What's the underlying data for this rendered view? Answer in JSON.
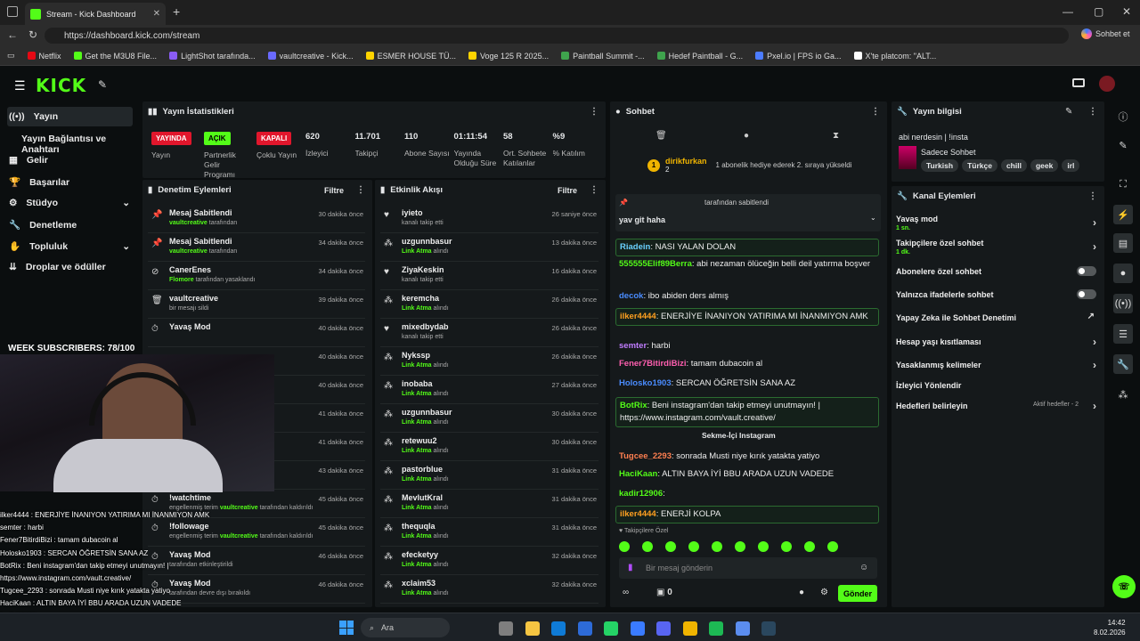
{
  "browser": {
    "tab_title": "Stream - Kick Dashboard",
    "url": "https://dashboard.kick.com/stream",
    "copilot": "Sohbet et",
    "bookmarks": [
      "Netflix",
      "Get the M3U8 File...",
      "LightShot tarafında...",
      "vaultcreative - Kick...",
      "ESMER HOUSE TÜ...",
      "Voge 125 R 2025...",
      "Paintball Summit -...",
      "Hedef Paintball - G...",
      "Pxel.io | FPS io Ga...",
      "X'te platcom: \"ALT..."
    ]
  },
  "brand": {
    "logo": "KICK",
    "beta": "BETA"
  },
  "sidebar": {
    "items": [
      "Yayın",
      "Yayın Bağlantısı ve Anahtarı",
      "Gelir",
      "Başarılar",
      "Stüdyo",
      "Denetleme",
      "Topluluk",
      "Droplar ve ödüller"
    ]
  },
  "stats": {
    "title": "Yayın İstatistikleri",
    "badges": [
      {
        "label": "YAYINDA",
        "sub": "Yayın",
        "color": "#e1162c"
      },
      {
        "label": "AÇIK",
        "sub": "Partnerlik Gelir Programı",
        "color": "#53fc18"
      },
      {
        "label": "KAPALI",
        "sub": "Çoklu Yayın",
        "color": "#e1162c"
      }
    ],
    "items": [
      {
        "value": "620",
        "label": "İzleyici"
      },
      {
        "value": "11.701",
        "label": "Takipçi"
      },
      {
        "value": "110",
        "label": "Abone Sayısı"
      },
      {
        "value": "01:11:54",
        "label": "Yayında Olduğu Süre"
      },
      {
        "value": "58",
        "label": "Ort. Sohbete Katılanlar"
      },
      {
        "value": "%9",
        "label": "% Katılım"
      }
    ]
  },
  "moderation": {
    "title": "Denetim Eylemleri",
    "filter": "Filtre",
    "rows": [
      {
        "icon": "pin-icon",
        "title": "Mesaj Sabitlendi",
        "user": "vaultcreative",
        "rest": " tarafından",
        "time": "30 dakika önce"
      },
      {
        "icon": "pin-icon",
        "title": "Mesaj Sabitlendi",
        "user": "vaultcreative",
        "rest": " tarafından",
        "time": "34 dakika önce"
      },
      {
        "icon": "ban-icon",
        "title": "CanerEnes",
        "user": "Flomore",
        "rest": " tarafından yasaklandı",
        "time": "34 dakika önce"
      },
      {
        "icon": "trash-icon",
        "title": "vaultcreative",
        "user": "",
        "rest": "bir mesajı sildi",
        "time": "39 dakika önce"
      },
      {
        "icon": "clock-icon",
        "title": "Yavaş Mod",
        "user": "",
        "rest": "",
        "time": "40 dakika önce"
      },
      {
        "icon": "",
        "title": "",
        "user": "",
        "rest": "",
        "time": "40 dakika önce"
      },
      {
        "icon": "",
        "title": "",
        "user": "",
        "rest": "kildi",
        "time": "40 dakika önce"
      },
      {
        "icon": "",
        "title": "",
        "user": "",
        "rest": "",
        "time": "41 dakika önce"
      },
      {
        "icon": "",
        "title": "",
        "user": "",
        "rest": "",
        "time": "41 dakika önce"
      },
      {
        "icon": "",
        "title": "",
        "user": "",
        "rest": "",
        "time": "43 dakika önce"
      },
      {
        "icon": "clock-icon",
        "title": "!watchtime",
        "user": "vaultcreative",
        "rest": " tarafından kaldırıldı",
        "pre": "engellenmiş terim ",
        "time": "45 dakika önce"
      },
      {
        "icon": "clock-icon",
        "title": "!followage",
        "user": "vaultcreative",
        "rest": " tarafından kaldırıldı",
        "pre": "engellenmiş terim ",
        "time": "45 dakika önce"
      },
      {
        "icon": "clock-icon",
        "title": "Yavaş Mod",
        "user": "",
        "rest": "tarafından etkinleştirildi",
        "time": "46 dakika önce"
      },
      {
        "icon": "clock-icon",
        "title": "Yavaş Mod",
        "user": "",
        "rest": "tarafından devre dışı bırakıldı",
        "time": "46 dakika önce"
      }
    ]
  },
  "activity": {
    "title": "Etkinlik Akışı",
    "filter": "Filtre",
    "rows": [
      {
        "icon": "heart-icon",
        "name": "iyieto",
        "sub": "kanalı takip etti",
        "time": "26 saniye önce",
        "green": false
      },
      {
        "icon": "loot-icon",
        "name": "uzgunnbasur",
        "sub": "Link Atma",
        "sub2": " alındı",
        "time": "13 dakika önce",
        "green": true
      },
      {
        "icon": "heart-icon",
        "name": "ZiyaKeskin",
        "sub": "kanalı takip etti",
        "time": "16 dakika önce",
        "green": false
      },
      {
        "icon": "loot-icon",
        "name": "keremcha",
        "sub": "Link Atma",
        "sub2": " alındı",
        "time": "26 dakika önce",
        "green": true
      },
      {
        "icon": "heart-icon",
        "name": "mixedbydab",
        "sub": "kanalı takip etti",
        "time": "26 dakika önce",
        "green": false
      },
      {
        "icon": "loot-icon",
        "name": "Nykssp",
        "sub": "Link Atma",
        "sub2": " alındı",
        "time": "26 dakika önce",
        "green": true
      },
      {
        "icon": "loot-icon",
        "name": "inobaba",
        "sub": "Link Atma",
        "sub2": " alındı",
        "time": "27 dakika önce",
        "green": true
      },
      {
        "icon": "loot-icon",
        "name": "uzgunnbasur",
        "sub": "Link Atma",
        "sub2": " alındı",
        "time": "30 dakika önce",
        "green": true
      },
      {
        "icon": "loot-icon",
        "name": "retewuu2",
        "sub": "Link Atma",
        "sub2": " alındı",
        "time": "30 dakika önce",
        "green": true
      },
      {
        "icon": "loot-icon",
        "name": "pastorblue",
        "sub": "Link Atma",
        "sub2": " alındı",
        "time": "31 dakika önce",
        "green": true
      },
      {
        "icon": "loot-icon",
        "name": "MevlutKral",
        "sub": "Link Atma",
        "sub2": " alındı",
        "time": "31 dakika önce",
        "green": true
      },
      {
        "icon": "loot-icon",
        "name": "thequqla",
        "sub": "Link Atma",
        "sub2": " alındı",
        "time": "31 dakika önce",
        "green": true
      },
      {
        "icon": "loot-icon",
        "name": "efecketyy",
        "sub": "Link Atma",
        "sub2": " alındı",
        "time": "32 dakika önce",
        "green": true
      },
      {
        "icon": "loot-icon",
        "name": "xclaim53",
        "sub": "Link Atma",
        "sub2": " alındı",
        "time": "32 dakika önce",
        "green": true
      }
    ]
  },
  "chat": {
    "title": "Sohbet",
    "gift_user": "dirikfurkan",
    "gift_count": "2",
    "gift_text": "1 abonelik hediye ederek 2. sıraya yükseldi",
    "pinned_by": "tarafından sabitlendi",
    "pinned_msg": "yav git haha",
    "messages": [
      {
        "user": "Riadein",
        "color": "#6ad0ff",
        "text": "NASI YALAN DOLAN",
        "hl": true
      },
      {
        "user": "555555Elif89Berra",
        "color": "#53fc18",
        "text": "abi nezaman ölüceğin belli deil yatırma boşver",
        "hl": false
      },
      {
        "user": "decok",
        "color": "#4a8cff",
        "text": "ibo abiden ders almış",
        "hl": false
      },
      {
        "user": "ilker4444",
        "color": "#ffa020",
        "text": "ENERJİYE İNANIYON YATIRIMA MI İNANMIYON AMK",
        "hl": true
      },
      {
        "user": "semter",
        "color": "#c07cff",
        "text": "harbi",
        "hl": false
      },
      {
        "user": "Fener7BitirdiBizi",
        "color": "#ff5fb0",
        "text": "tamam dubacoin al",
        "hl": false
      },
      {
        "user": "Holosko1903",
        "color": "#4a8cff",
        "text": "SERCAN ÖĞRETSİN SANA AZ",
        "hl": false
      },
      {
        "user": "BotRix",
        "color": "#53fc18",
        "text": "Beni instagram'dan takip etmeyi unutmayın! | https://www.instagram.com/vault.creative/",
        "hl": true
      },
      {
        "user": "Tugcee_2293",
        "color": "#ff7f50",
        "text": "sonrada Musti niye kırık yatakta yatiyo",
        "hl": false
      },
      {
        "user": "HaciKaan",
        "color": "#53fc18",
        "text": "ALTIN BAYA İYİ BBU ARADA UZUN VADEDE",
        "hl": false
      },
      {
        "user": "kadir12906",
        "color": "#53fc18",
        "text": "",
        "hl": false
      },
      {
        "user": "ilker4444",
        "color": "#ffa020",
        "text": "ENERJİ KOLPA",
        "hl": true
      }
    ],
    "instagram_btn": "Sekme-İçi Instagram",
    "followers_only": "Takipçilere Özel",
    "placeholder": "Bir mesaj gönderin",
    "count": "0",
    "send": "Gönder"
  },
  "stream_info": {
    "title": "Yayın bilgisi",
    "stream_title": "abi nerdesin | !insta",
    "category": "Sadece Sohbet",
    "tags": [
      "Turkish",
      "Türkçe",
      "chill",
      "geek",
      "irl"
    ]
  },
  "channel_actions": {
    "title": "Kanal Eylemleri",
    "items": [
      {
        "label": "Yavaş mod",
        "sub": "1 sn.",
        "ctl": "chev"
      },
      {
        "label": "Takipçilere özel sohbet",
        "sub": "1 dk.",
        "ctl": "chev"
      },
      {
        "label": "Abonelere özel sohbet",
        "sub": "",
        "ctl": "toggle"
      },
      {
        "label": "Yalnızca ifadelerle sohbet",
        "sub": "",
        "ctl": "toggle"
      },
      {
        "label": "Yapay Zeka ile Sohbet Denetimi",
        "sub": "",
        "ctl": "ext"
      },
      {
        "label": "Hesap yaşı kısıtlaması",
        "sub": "",
        "ctl": "chev"
      },
      {
        "label": "Yasaklanmış kelimeler",
        "sub": "",
        "ctl": "chev"
      },
      {
        "label": "İzleyici Yönlendir",
        "sub": "",
        "ctl": ""
      },
      {
        "label": "Hedefleri belirleyin",
        "sub": "",
        "ctl": "chev",
        "extra": "Aktif hedefler - 2"
      }
    ]
  },
  "overlay": {
    "subs": "WEEK SUBSCRIBERS: 78/100",
    "lines": [
      "ilker4444 : ENERJİYE İNANIYON YATIRIMA MI İNANMIYON AMK",
      "semter : harbi",
      "Fener7BitirdiBizi : tamam dubacoin al",
      "Holosko1903 : SERCAN ÖĞRETSİN SANA AZ",
      "BotRix : Beni instagram'dan takip etmeyi unutmayın! |",
      "https://www.instagram.com/vault.creative/",
      "Tugcee_2293 : sonrada Musti niye kırık yatakta yatiyo",
      "HaciKaan : ALTIN BAYA İYİ BBU ARADA UZUN VADEDE",
      "kadir12906 :",
      "ilker4444 : ENERJİ KOLPA"
    ]
  },
  "taskbar": {
    "search": "Ara",
    "time": "14:42",
    "date": "8.02.2026"
  }
}
